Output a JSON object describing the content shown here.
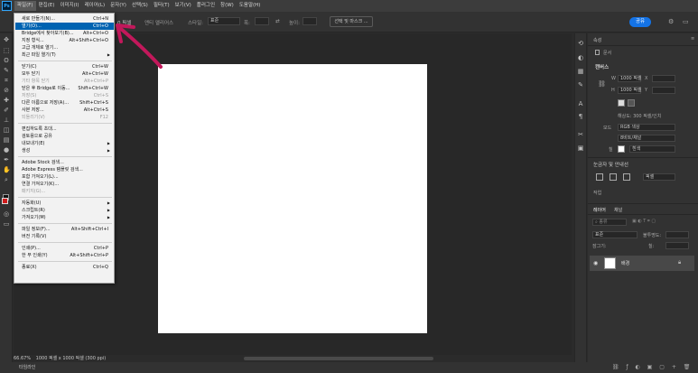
{
  "menubar": {
    "logo": "Ps",
    "items": [
      "파일(F)",
      "편집(E)",
      "이미지(I)",
      "레이어(L)",
      "문자(Y)",
      "선택(S)",
      "필터(T)",
      "보기(V)",
      "플러그인",
      "창(W)",
      "도움말(H)"
    ]
  },
  "options": {
    "feather_label": "폭:",
    "feather_value": "0 픽셀",
    "antialias_label": "앤티 앨리어스",
    "style_label": "스타일:",
    "style_value": "표준",
    "width_label": "폭:",
    "height_label": "높이:",
    "select_mask": "선택 및 마스크 ...",
    "share": "공유"
  },
  "file_menu": [
    {
      "label": "새로 만들기(N)...",
      "shortcut": "Ctrl+N"
    },
    {
      "label": "열기(O)...",
      "shortcut": "Ctrl+O",
      "highlight": true
    },
    {
      "label": "Bridge에서 찾아보기(B)...",
      "shortcut": "Alt+Ctrl+O"
    },
    {
      "label": "지정 형식...",
      "shortcut": "Alt+Shift+Ctrl+O"
    },
    {
      "label": "고급 개체로 열기...",
      "shortcut": ""
    },
    {
      "label": "최근 파일 열기(T)",
      "shortcut": "",
      "submenu": true
    },
    {
      "sep": true
    },
    {
      "label": "닫기(C)",
      "shortcut": "Ctrl+W"
    },
    {
      "label": "모두 닫기",
      "shortcut": "Alt+Ctrl+W"
    },
    {
      "label": "기타 항목 닫기",
      "shortcut": "Alt+Ctrl+P",
      "disabled": true
    },
    {
      "label": "닫은 후 Bridge로 이동...",
      "shortcut": "Shift+Ctrl+W"
    },
    {
      "label": "저장(S)",
      "shortcut": "Ctrl+S",
      "disabled": true
    },
    {
      "label": "다른 이름으로 저장(A)...",
      "shortcut": "Shift+Ctrl+S"
    },
    {
      "label": "사본 저장...",
      "shortcut": "Alt+Ctrl+S"
    },
    {
      "label": "되돌리기(V)",
      "shortcut": "F12",
      "disabled": true
    },
    {
      "sep": true
    },
    {
      "label": "편집하도록 초대...",
      "shortcut": ""
    },
    {
      "label": "검토용으로 공유",
      "shortcut": ""
    },
    {
      "label": "내보내기(E)",
      "shortcut": "",
      "submenu": true
    },
    {
      "label": "생성",
      "shortcut": "",
      "submenu": true
    },
    {
      "sep": true
    },
    {
      "label": "Adobe Stock 검색...",
      "shortcut": ""
    },
    {
      "label": "Adobe Express 템플릿 검색...",
      "shortcut": ""
    },
    {
      "label": "포함 가져오기(L)...",
      "shortcut": ""
    },
    {
      "label": "연결 가져오기(K)...",
      "shortcut": ""
    },
    {
      "label": "패키지(G)...",
      "shortcut": "",
      "disabled": true
    },
    {
      "sep": true
    },
    {
      "label": "자동화(U)",
      "shortcut": "",
      "submenu": true
    },
    {
      "label": "스크립트(R)",
      "shortcut": "",
      "submenu": true
    },
    {
      "label": "가져오기(M)",
      "shortcut": "",
      "submenu": true
    },
    {
      "sep": true
    },
    {
      "label": "파일 정보(F)...",
      "shortcut": "Alt+Shift+Ctrl+I"
    },
    {
      "label": "버전 기록(V)",
      "shortcut": ""
    },
    {
      "sep": true
    },
    {
      "label": "인쇄(P)...",
      "shortcut": "Ctrl+P"
    },
    {
      "label": "한 부 인쇄(Y)",
      "shortcut": "Alt+Shift+Ctrl+P"
    },
    {
      "sep": true
    },
    {
      "label": "종료(X)",
      "shortcut": "Ctrl+Q"
    }
  ],
  "status": {
    "zoom": "66.67%",
    "doc_info": "1000 픽셀 x 1000 픽셀 (300 ppi)",
    "timeline": "타임라인"
  },
  "properties_panel": {
    "tab": "속성",
    "doc_label": "문서",
    "canvas_heading": "캔버스",
    "w_label": "W",
    "w_value": "1000 픽셀",
    "h_label": "H",
    "h_value": "1000 픽셀",
    "x_label": "X",
    "y_label": "Y",
    "resolution": "해상도: 300 픽셀/인치",
    "mode_label": "모드",
    "mode_value": "RGB 색상",
    "bit_value": "8비트/채널",
    "fill_label": "칠",
    "fill_value": "흰색",
    "guides_heading": "눈금자 및 안내선",
    "guides_unit": "픽셀",
    "more_heading": "작업"
  },
  "layers_panel": {
    "tabs": [
      "레이어",
      "채널"
    ],
    "search_placeholder": "종류",
    "blend_mode": "표준",
    "opacity_label": "불투명도:",
    "lock_label": "잠그기:",
    "fill_label": "칠:",
    "layer_name": "배경"
  }
}
